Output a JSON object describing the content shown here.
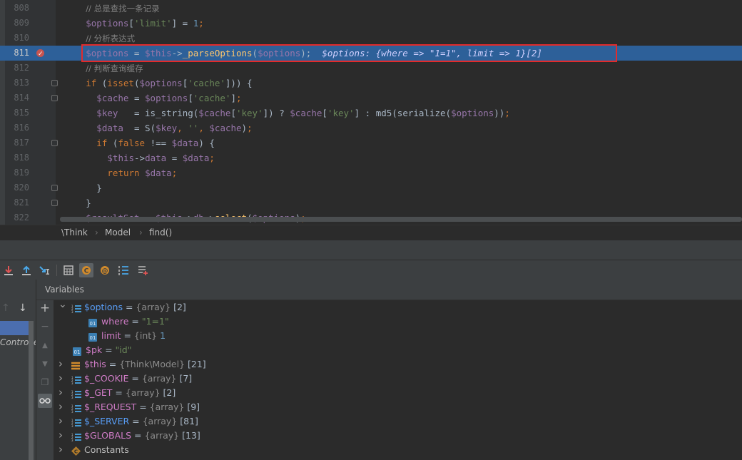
{
  "editor": {
    "lines": [
      {
        "no": "808",
        "type": "comment",
        "indent": 4,
        "text": "// 总是查找一条记录"
      },
      {
        "no": "809",
        "type": "code",
        "indent": 4,
        "html_key": "l809"
      },
      {
        "no": "810",
        "type": "comment",
        "indent": 4,
        "text": "// 分析表达式"
      },
      {
        "no": "811",
        "type": "code",
        "indent": 4,
        "html_key": "l811",
        "current": true
      },
      {
        "no": "812",
        "type": "comment",
        "indent": 4,
        "text": "// 判断查询缓存"
      },
      {
        "no": "813",
        "type": "code",
        "indent": 4,
        "html_key": "l813"
      },
      {
        "no": "814",
        "type": "code",
        "indent": 6,
        "html_key": "l814"
      },
      {
        "no": "815",
        "type": "code",
        "indent": 6,
        "html_key": "l815"
      },
      {
        "no": "816",
        "type": "code",
        "indent": 6,
        "html_key": "l816"
      },
      {
        "no": "817",
        "type": "code",
        "indent": 6,
        "html_key": "l817"
      },
      {
        "no": "818",
        "type": "code",
        "indent": 8,
        "html_key": "l818"
      },
      {
        "no": "819",
        "type": "code",
        "indent": 8,
        "html_key": "l819"
      },
      {
        "no": "820",
        "type": "code",
        "indent": 6,
        "html_key": "l820"
      },
      {
        "no": "821",
        "type": "code",
        "indent": 4,
        "html_key": "l821"
      },
      {
        "no": "822",
        "type": "code",
        "indent": 4,
        "html_key": "l822"
      }
    ],
    "tokens": {
      "l809": [
        [
          "v",
          "$options"
        ],
        [
          "i",
          "["
        ],
        [
          "s",
          "'limit'"
        ],
        [
          "i",
          "] = "
        ],
        [
          "n",
          "1"
        ],
        [
          "k",
          ";"
        ]
      ],
      "l811": [
        [
          "v",
          "$options"
        ],
        [
          "i",
          " = "
        ],
        [
          "v",
          "$this"
        ],
        [
          "i",
          "->"
        ],
        [
          "f",
          "_parseOptions"
        ],
        [
          "i",
          "("
        ],
        [
          "v",
          "$options"
        ],
        [
          "i",
          ");"
        ],
        [
          "h",
          "  $options: {where => \"1=1\", limit => 1}[2]"
        ]
      ],
      "l813": [
        [
          "k",
          "if "
        ],
        [
          "i",
          "("
        ],
        [
          "k",
          "isset"
        ],
        [
          "i",
          "("
        ],
        [
          "v",
          "$options"
        ],
        [
          "i",
          "["
        ],
        [
          "s",
          "'cache'"
        ],
        [
          "i",
          "])) {"
        ]
      ],
      "l814": [
        [
          "v",
          "$cache"
        ],
        [
          "i",
          " = "
        ],
        [
          "v",
          "$options"
        ],
        [
          "i",
          "["
        ],
        [
          "s",
          "'cache'"
        ],
        [
          "i",
          "]"
        ],
        [
          "k",
          ";"
        ]
      ],
      "l815": [
        [
          "v",
          "$key"
        ],
        [
          "i",
          "   = is_string("
        ],
        [
          "v",
          "$cache"
        ],
        [
          "i",
          "["
        ],
        [
          "s",
          "'key'"
        ],
        [
          "i",
          "]) ? "
        ],
        [
          "v",
          "$cache"
        ],
        [
          "i",
          "["
        ],
        [
          "s",
          "'key'"
        ],
        [
          "i",
          "] : md5(serialize("
        ],
        [
          "v",
          "$options"
        ],
        [
          "i",
          "))"
        ],
        [
          "k",
          ";"
        ]
      ],
      "l816": [
        [
          "v",
          "$data"
        ],
        [
          "i",
          "  = S("
        ],
        [
          "v",
          "$key"
        ],
        [
          "k",
          ", "
        ],
        [
          "s",
          "''"
        ],
        [
          "k",
          ", "
        ],
        [
          "v",
          "$cache"
        ],
        [
          "i",
          ")"
        ],
        [
          "k",
          ";"
        ]
      ],
      "l817": [
        [
          "k",
          "if "
        ],
        [
          "i",
          "("
        ],
        [
          "k",
          "false "
        ],
        [
          "i",
          "!== "
        ],
        [
          "v",
          "$data"
        ],
        [
          "i",
          ") {"
        ]
      ],
      "l818": [
        [
          "v",
          "$this"
        ],
        [
          "i",
          "->"
        ],
        [
          "v",
          "data"
        ],
        [
          "i",
          " = "
        ],
        [
          "v",
          "$data"
        ],
        [
          "k",
          ";"
        ]
      ],
      "l819": [
        [
          "k",
          "return "
        ],
        [
          "v",
          "$data"
        ],
        [
          "k",
          ";"
        ]
      ],
      "l820": [
        [
          "i",
          "}"
        ]
      ],
      "l821": [
        [
          "i",
          "}"
        ]
      ],
      "l822": [
        [
          "v",
          "$resultSet"
        ],
        [
          "i",
          " = "
        ],
        [
          "v",
          "$this"
        ],
        [
          "i",
          "->"
        ],
        [
          "v",
          "db"
        ],
        [
          "i",
          "->"
        ],
        [
          "f",
          "select"
        ],
        [
          "i",
          "("
        ],
        [
          "v",
          "$options"
        ],
        [
          "i",
          ")"
        ],
        [
          "k",
          ";"
        ]
      ]
    }
  },
  "breadcrumb": {
    "items": [
      "\\Think",
      "Model",
      "find()"
    ]
  },
  "debugger": {
    "toolbar_icons": [
      "step-into-icon",
      "step-out-icon",
      "run-to-cursor-icon",
      "evaluate-icon",
      "restore-layout-icon",
      "settings-icon",
      "frames-list-icon",
      "add-watch-icon"
    ],
    "variables_title": "Variables",
    "frame_label": "Controlle",
    "variables": [
      {
        "depth": 0,
        "expand": "open",
        "icon": "array",
        "name": "$options",
        "name_class": "opt",
        "type": "{array}",
        "count": "[2]"
      },
      {
        "depth": 1,
        "expand": "none",
        "icon": "field",
        "name": "where",
        "name_class": "top",
        "value": "\"1=1\"",
        "value_class": "str"
      },
      {
        "depth": 1,
        "expand": "none",
        "icon": "field",
        "name": "limit",
        "name_class": "top",
        "type": "{int}",
        "value": "1",
        "value_class": "num"
      },
      {
        "depth": 0,
        "expand": "none",
        "icon": "field",
        "name": "$pk",
        "name_class": "top",
        "value": "\"id\"",
        "value_class": "str"
      },
      {
        "depth": 0,
        "expand": "closed",
        "icon": "object",
        "name": "$this",
        "name_class": "top",
        "type": "{Think\\Model}",
        "count": "[21]"
      },
      {
        "depth": 0,
        "expand": "closed",
        "icon": "array",
        "name": "$_COOKIE",
        "name_class": "top",
        "type": "{array}",
        "count": "[7]"
      },
      {
        "depth": 0,
        "expand": "closed",
        "icon": "array",
        "name": "$_GET",
        "name_class": "top",
        "type": "{array}",
        "count": "[2]"
      },
      {
        "depth": 0,
        "expand": "closed",
        "icon": "array",
        "name": "$_REQUEST",
        "name_class": "top",
        "type": "{array}",
        "count": "[9]"
      },
      {
        "depth": 0,
        "expand": "closed",
        "icon": "array",
        "name": "$_SERVER",
        "name_class": "opt",
        "type": "{array}",
        "count": "[81]"
      },
      {
        "depth": 0,
        "expand": "closed",
        "icon": "array",
        "name": "$GLOBALS",
        "name_class": "top",
        "type": "{array}",
        "count": "[13]"
      },
      {
        "depth": 0,
        "expand": "closed",
        "icon": "constants",
        "name": "Constants",
        "name_class": "plain"
      }
    ]
  },
  "colors": {
    "current_line": "#2d6099",
    "highlight_box": "#e22b2b",
    "breakpoint": "#c75450"
  }
}
